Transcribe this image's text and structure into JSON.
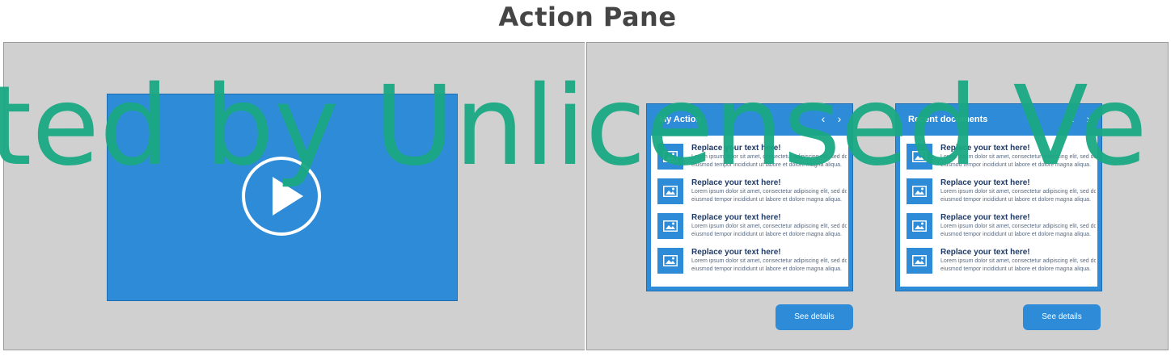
{
  "page": {
    "title": "Action Pane"
  },
  "video": {
    "play_icon": "play-icon",
    "accent": "#2e8bd8"
  },
  "cards": [
    {
      "title": "My Action",
      "prev": "‹",
      "next": "›",
      "items": [
        {
          "title": "Replace your text here!",
          "line1": "Lorem ipsum dolor sit amet, consectetur adipiscing elit, sed do",
          "line2": "eiusmod tempor incididunt ut labore et dolore magna aliqua."
        },
        {
          "title": "Replace your text here!",
          "line1": "Lorem ipsum dolor sit amet, consectetur adipiscing elit, sed do",
          "line2": "eiusmod tempor incididunt ut labore et dolore magna aliqua."
        },
        {
          "title": "Replace your text here!",
          "line1": "Lorem ipsum dolor sit amet, consectetur adipiscing elit, sed do",
          "line2": "eiusmod tempor incididunt ut labore et dolore magna aliqua."
        },
        {
          "title": "Replace your text here!",
          "line1": "Lorem ipsum dolor sit amet, consectetur adipiscing elit, sed do",
          "line2": "eiusmod tempor incididunt ut labore et dolore magna aliqua."
        }
      ],
      "button": "See details"
    },
    {
      "title": "Recent documents",
      "prev": "‹",
      "next": "›",
      "items": [
        {
          "title": "Replace your text here!",
          "line1": "Lorem ipsum dolor sit amet, consectetur adipiscing elit, sed do",
          "line2": "eiusmod tempor incididunt ut labore et dolore magna aliqua."
        },
        {
          "title": "Replace your text here!",
          "line1": "Lorem ipsum dolor sit amet, consectetur adipiscing elit, sed do",
          "line2": "eiusmod tempor incididunt ut labore et dolore magna aliqua."
        },
        {
          "title": "Replace your text here!",
          "line1": "Lorem ipsum dolor sit amet, consectetur adipiscing elit, sed do",
          "line2": "eiusmod tempor incididunt ut labore et dolore magna aliqua."
        },
        {
          "title": "Replace your text here!",
          "line1": "Lorem ipsum dolor sit amet, consectetur adipiscing elit, sed do",
          "line2": "eiusmod tempor incididunt ut labore et dolore magna aliqua."
        }
      ],
      "button": "See details"
    }
  ],
  "watermark": "ted by Unlicensed Ve",
  "colors": {
    "accent": "#2e8bd8",
    "panel": "#d0d0d0",
    "watermark": "#1aa883"
  }
}
